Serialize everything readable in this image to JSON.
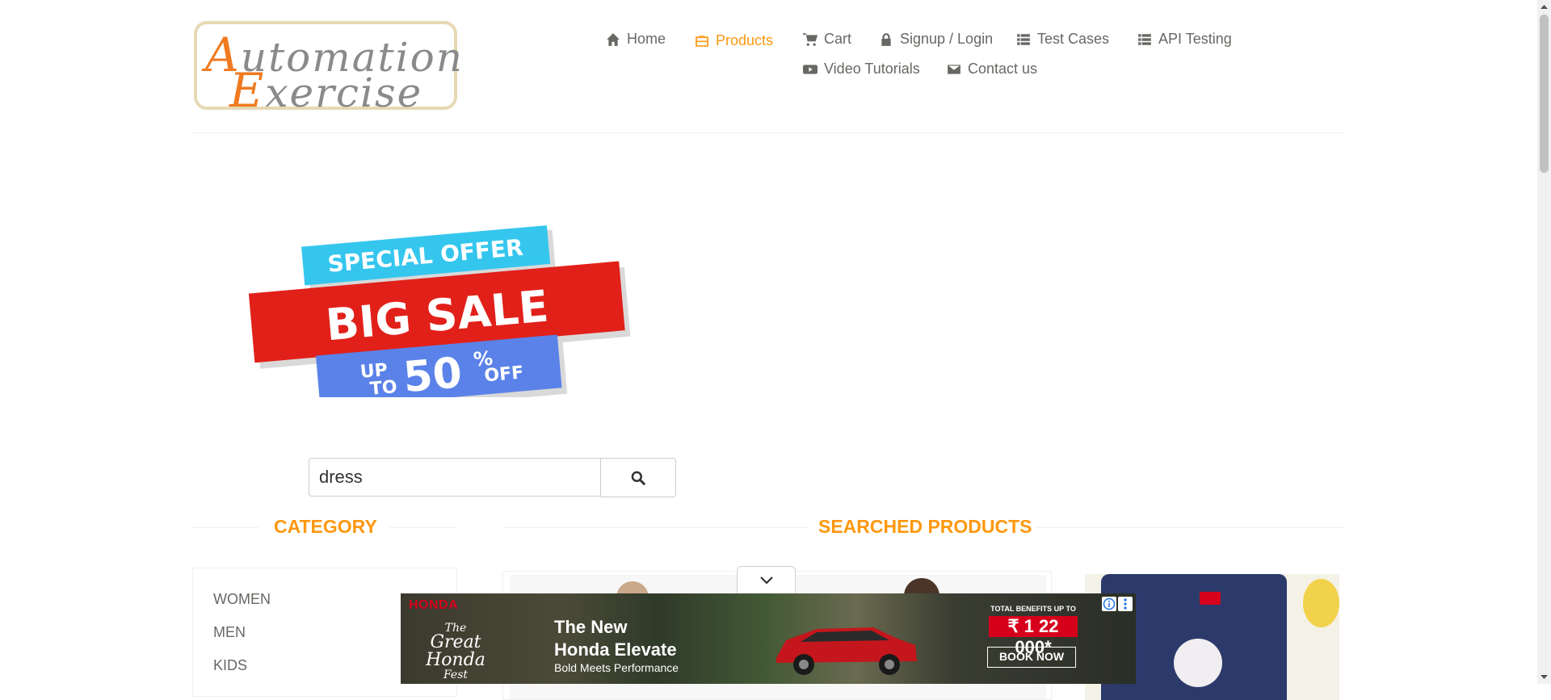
{
  "logo": {
    "line1_cap": "A",
    "line1_rest": "utomation",
    "line2_cap": "E",
    "line2_rest": "xercise"
  },
  "nav": {
    "home": "Home",
    "products": "Products",
    "cart": "Cart",
    "signup_login": "Signup / Login",
    "test_cases": "Test Cases",
    "api_testing": "API Testing",
    "video_tutorials": "Video Tutorials",
    "contact_us": "Contact us"
  },
  "banner": {
    "line1": "SPECIAL OFFER",
    "line2": "BIG SALE",
    "up": "UP",
    "to": "TO",
    "percent_value": "50",
    "percent_sign": "%",
    "off": "OFF"
  },
  "search": {
    "value": "dress"
  },
  "sections": {
    "category": "CATEGORY",
    "searched_products": "SEARCHED PRODUCTS"
  },
  "categories": [
    "WOMEN",
    "MEN",
    "KIDS"
  ],
  "ad": {
    "brand": "HONDA",
    "fest_the": "The",
    "fest_great": "Great",
    "fest_honda": "Honda",
    "fest_fest": "Fest",
    "headline_1": "The New",
    "headline_2": "Honda Elevate",
    "subline": "Bold Meets Performance",
    "total_label": "TOTAL BENEFITS UP TO",
    "price": "₹ 1 22 000*",
    "cta": "BOOK NOW"
  },
  "colors": {
    "accent": "#fe980f",
    "text": "#696763",
    "banner_cyan": "#35c6ee",
    "banner_red": "#e2201a",
    "banner_blue": "#5a82e8"
  },
  "icons": {
    "home": "home-icon",
    "products": "briefcase-icon",
    "cart": "cart-icon",
    "login": "lock-icon",
    "test_cases": "list-icon",
    "api": "list-icon",
    "video": "youtube-icon",
    "contact": "envelope-icon",
    "search": "search-icon"
  }
}
